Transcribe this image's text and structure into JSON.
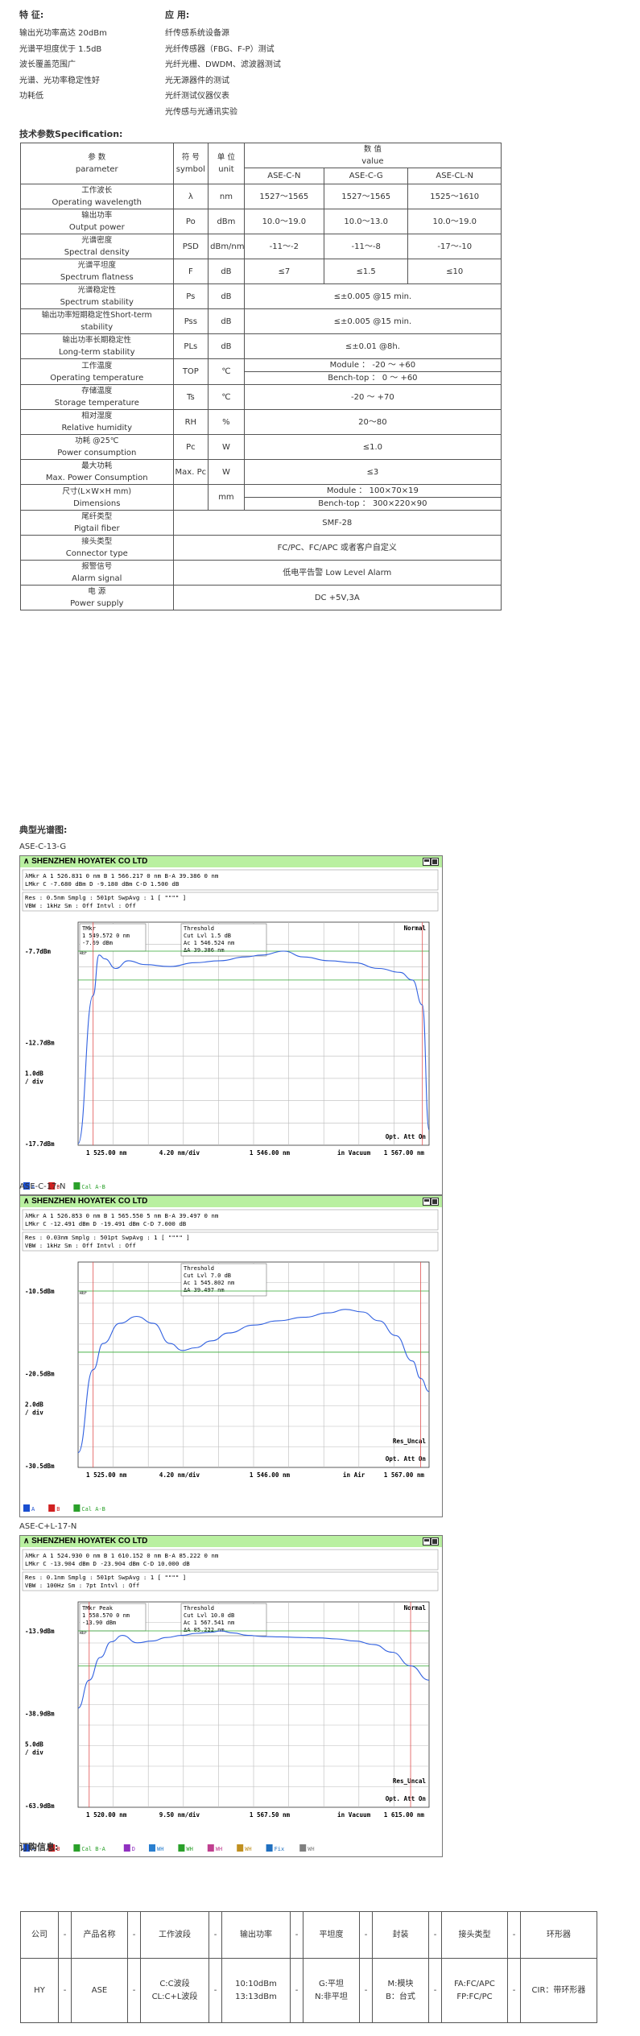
{
  "features": {
    "heading": "特 征:",
    "items": [
      "输出光功率高达 20dBm",
      "光谱平坦度优于 1.5dB",
      "波长覆盖范围广",
      "光谱、光功率稳定性好",
      "功耗低"
    ]
  },
  "applications": {
    "heading": "应 用:",
    "items": [
      "纤传感系统设备源",
      "光纤传感器（FBG、F-P）测试",
      "光纤光栅、DWDM、滤波器测试",
      "光无源器件的测试",
      "光纤测试仪器仪表",
      "光传感与光通讯实验"
    ]
  },
  "spec_title": "技术参数Specification:",
  "spec": {
    "header": {
      "param_cn": "参 数",
      "param_en": "parameter",
      "sym_cn": "符 号",
      "sym_en": "symbol",
      "unit_cn": "单 位",
      "unit_en": "unit",
      "value_cn": "数 值",
      "value_en": "value",
      "models": [
        "ASE-C-N",
        "ASE-C-G",
        "ASE-CL-N"
      ]
    },
    "rows": [
      {
        "cn": "工作波长",
        "en": "Operating wavelength",
        "sym": "λ",
        "unit": "nm",
        "vals": [
          "1527～1565",
          "1527～1565",
          "1525～1610"
        ]
      },
      {
        "cn": "输出功率",
        "en": "Output power",
        "sym": "Po",
        "unit": "dBm",
        "vals": [
          "10.0～19.0",
          "10.0～13.0",
          "10.0～19.0"
        ]
      },
      {
        "cn": "光谱密度",
        "en": "Spectral density",
        "sym": "PSD",
        "unit": "dBm/nm",
        "vals": [
          "-11～-2",
          "-11～-8",
          "-17～-10"
        ]
      },
      {
        "cn": "光谱平坦度",
        "en": "Spectrum flatness",
        "sym": "F",
        "unit": "dB",
        "vals": [
          "≤7",
          "≤1.5",
          "≤10"
        ]
      },
      {
        "cn": "光谱稳定性",
        "en": "Spectrum stability",
        "sym": "Ps",
        "unit": "dB",
        "span": "≤±0.005  @15 min."
      },
      {
        "cn": "输出功率短期稳定性Short-term",
        "en": "stability",
        "sym": "Pss",
        "unit": "dB",
        "span": "≤±0.005  @15 min."
      },
      {
        "cn": "输出功率长期稳定性",
        "en": "Long-term stability",
        "sym": "PLs",
        "unit": "dB",
        "span": "≤±0.01  @8h."
      },
      {
        "cn": "工作温度",
        "en": "Operating temperature",
        "sym": "TOP",
        "unit": "℃",
        "split": [
          "Module ： -20 ～ +60",
          "Bench-top ： 0 ～ +60"
        ]
      },
      {
        "cn": "存储温度",
        "en": "Storage temperature",
        "sym": "Ts",
        "unit": "℃",
        "span": "-20 ～ +70"
      },
      {
        "cn": "相对湿度",
        "en": "Relative humidity",
        "sym": "RH",
        "unit": "%",
        "span": "20～80"
      },
      {
        "cn": "功耗 @25℃",
        "en": "Power consumption",
        "sym": "Pc",
        "unit": "W",
        "span": "≤1.0"
      },
      {
        "cn": "最大功耗",
        "en": "Max. Power Consumption",
        "sym": "Max. Pc",
        "unit": "W",
        "span": "≤3"
      },
      {
        "cn": "尺寸(L×W×H mm)",
        "en": "Dimensions",
        "sym": "",
        "unit": "mm",
        "split": [
          "Module ：  100×70×19",
          "Bench-top ：  300×220×90"
        ]
      },
      {
        "cn": "尾纤类型",
        "en": "Pigtail fiber",
        "full": "SMF-28"
      },
      {
        "cn": "接头类型",
        "en": "Connector type",
        "full": "FC/PC、FC/APC 或者客户自定义"
      },
      {
        "cn": "报警信号",
        "en": "Alarm signal",
        "full": "低电平告警   Low Level Alarm"
      },
      {
        "cn": "电 源",
        "en": "Power supply",
        "full": "DC +5V,3A"
      }
    ]
  },
  "spectra_title": "典型光谱图:",
  "charts": [
    {
      "caption": "ASE-C-13-G",
      "company": "SHENZHEN HOYATEK CO LTD",
      "marker_lines": [
        "λMkr      A       1 526.831 0   nm        B         1 566.217 0   nm     B-A        39.386 0   nm",
        "LMkr      C          -7.680   dBm         D            -9.180   dBm     C-D         1.500   dB"
      ],
      "setup_lines": [
        "Res :  0.5nm          Smplg :    501pt      SwpAvg :    1 [   \"\"\"\" ]",
        "VBW :  1kHz      Sm :  Off    Intvl :  Off"
      ],
      "ref_levels": [
        "-7.7dBm",
        "-12.7dBm",
        "-17.7dBm"
      ],
      "scale": [
        "1.0dB",
        "/ div"
      ],
      "mode": "Normal",
      "notes": [
        "Opt. Att On"
      ],
      "footer": [
        "1 525.00 nm",
        "4.20 nm/div",
        "1 546.00 nm",
        "in Vacuum",
        "1 567.00 nm"
      ],
      "box_lines": [
        "TMkr",
        "1 549.572 0   nm",
        "-7.69  dBm"
      ],
      "thr_lines": [
        "Threshold",
        "Cut Lvl          1.5  dB",
        "Ac           1 546.524  nm",
        "ΔA              39.386  nm"
      ],
      "traces": [
        "A",
        "B",
        "Cal A-B"
      ],
      "chart_data": {
        "type": "line",
        "x_range": [
          1525.0,
          1567.0
        ],
        "y_range": [
          -17.7,
          -7.7
        ],
        "series": [
          {
            "values": [
              [
                1525.0,
                -17.7
              ],
              [
                1526.8,
                -10.0
              ],
              [
                1527.5,
                -7.9
              ],
              [
                1528.2,
                -8.1
              ],
              [
                1529.5,
                -8.6
              ],
              [
                1531.0,
                -8.2
              ],
              [
                1533.0,
                -8.4
              ],
              [
                1536.0,
                -8.5
              ],
              [
                1539.0,
                -8.3
              ],
              [
                1542.0,
                -8.2
              ],
              [
                1545.0,
                -8.0
              ],
              [
                1547.0,
                -7.9
              ],
              [
                1549.6,
                -7.7
              ],
              [
                1552.0,
                -8.0
              ],
              [
                1555.0,
                -8.2
              ],
              [
                1558.0,
                -8.3
              ],
              [
                1561.0,
                -8.6
              ],
              [
                1563.5,
                -8.8
              ],
              [
                1565.0,
                -9.2
              ],
              [
                1566.2,
                -10.5
              ],
              [
                1567.0,
                -17.0
              ]
            ]
          }
        ]
      }
    },
    {
      "caption": "ASE-C-17-N",
      "company": "SHENZHEN HOYATEK CO LTD",
      "marker_lines": [
        "λMkr      A       1 526.853 0   nm        B         1 565.550 5   nm     B-A        39.497 0   nm",
        "LMkr      C         -12.491   dBm         D           -19.491   dBm     C-D         7.000   dB"
      ],
      "setup_lines": [
        "Res :  0.03nm         Smplg :    501pt      SwpAvg :    1 [   \"\"\"\" ]",
        "VBW :  1kHz      Sm :  Off    Intvl :  Off"
      ],
      "ref_levels": [
        "-10.5dBm",
        "-20.5dBm",
        "-30.5dBm"
      ],
      "scale": [
        "2.0dB",
        "/ div"
      ],
      "mode": "",
      "notes": [
        "Res_Uncal",
        "Opt. Att On"
      ],
      "footer": [
        "1 525.00 nm",
        "4.20 nm/div",
        "1 546.00 nm",
        "in Air",
        "1 567.00 nm"
      ],
      "box_lines": [],
      "thr_lines": [
        "Threshold",
        "Cut Lvl          7.0  dB",
        "Ac           1 545.802  nm",
        "ΔA              39.497  nm"
      ],
      "traces": [
        "A",
        "B",
        "Cal A-B"
      ],
      "chart_data": {
        "type": "line",
        "x_range": [
          1525.0,
          1567.0
        ],
        "y_range": [
          -30.5,
          -10.5
        ],
        "series": [
          {
            "values": [
              [
                1525.0,
                -29.0
              ],
              [
                1526.8,
                -19.5
              ],
              [
                1528.0,
                -16.5
              ],
              [
                1530.0,
                -14.2
              ],
              [
                1532.0,
                -13.4
              ],
              [
                1534.0,
                -14.2
              ],
              [
                1536.0,
                -16.5
              ],
              [
                1537.5,
                -17.3
              ],
              [
                1539.0,
                -17.0
              ],
              [
                1541.0,
                -16.2
              ],
              [
                1543.0,
                -15.3
              ],
              [
                1546.0,
                -14.4
              ],
              [
                1549.0,
                -13.9
              ],
              [
                1552.0,
                -13.5
              ],
              [
                1555.0,
                -13.0
              ],
              [
                1557.0,
                -12.6
              ],
              [
                1559.0,
                -12.9
              ],
              [
                1561.0,
                -13.9
              ],
              [
                1563.0,
                -15.6
              ],
              [
                1565.0,
                -18.5
              ],
              [
                1566.0,
                -20.5
              ],
              [
                1567.0,
                -22.0
              ]
            ]
          }
        ]
      }
    },
    {
      "caption": "ASE-C+L-17-N",
      "company": "SHENZHEN HOYATEK CO LTD",
      "marker_lines": [
        "λMkr      A       1 524.930 0   nm        B         1 610.152 0   nm     B-A        85.222 0   nm",
        "LMkr      C         -13.904   dBm         D           -23.904   dBm     C-D        10.000   dB"
      ],
      "setup_lines": [
        "Res :  0.1nm          Smplg :    501pt      SwpAvg :    1 [   \"\"\"\" ]",
        "VBW :  100Hz      Sm :  7pt    Intvl :  Off"
      ],
      "ref_levels": [
        "-13.9dBm",
        "-38.9dBm",
        "-63.9dBm"
      ],
      "scale": [
        "5.0dB",
        "/ div"
      ],
      "mode": "Normal",
      "notes": [
        "Res_Uncal",
        "Opt. Att On"
      ],
      "footer": [
        "1 520.00 nm",
        "9.50 nm/div",
        "1 567.50 nm",
        "in Vacuum",
        "1 615.00 nm"
      ],
      "box_lines": [
        "TMkr    Peak",
        "1 558.570 0   nm",
        "-13.90  dBm"
      ],
      "thr_lines": [
        "Threshold",
        "Cut Lvl         10.0  dB",
        "Ac           1 567.541  nm",
        "ΔA              85.222  nm"
      ],
      "traces": [
        "A",
        "B",
        "Cal B-A",
        "D",
        "WH",
        "WH",
        "WH",
        "WH",
        "Fix",
        "WH"
      ],
      "chart_data": {
        "type": "line",
        "x_range": [
          1520.0,
          1615.0
        ],
        "y_range": [
          -63.9,
          -13.9
        ],
        "series": [
          {
            "values": [
              [
                1520.0,
                -36.0
              ],
              [
                1523.0,
                -28.0
              ],
              [
                1526.0,
                -21.5
              ],
              [
                1529.0,
                -17.0
              ],
              [
                1532.0,
                -15.2
              ],
              [
                1536.0,
                -17.3
              ],
              [
                1540.0,
                -16.8
              ],
              [
                1544.0,
                -15.8
              ],
              [
                1548.0,
                -15.2
              ],
              [
                1552.0,
                -14.6
              ],
              [
                1556.0,
                -14.3
              ],
              [
                1558.6,
                -13.9
              ],
              [
                1562.0,
                -14.5
              ],
              [
                1566.0,
                -15.2
              ],
              [
                1570.0,
                -15.5
              ],
              [
                1575.0,
                -15.6
              ],
              [
                1580.0,
                -15.8
              ],
              [
                1585.0,
                -15.9
              ],
              [
                1590.0,
                -16.2
              ],
              [
                1595.0,
                -16.8
              ],
              [
                1600.0,
                -17.8
              ],
              [
                1605.0,
                -20.0
              ],
              [
                1610.0,
                -23.9
              ],
              [
                1615.0,
                -28.0
              ]
            ]
          }
        ]
      }
    }
  ],
  "order_title": "订购信息:",
  "order": {
    "header": [
      "公司",
      "-",
      "产品名称",
      "-",
      "工作波段",
      "-",
      "输出功率",
      "-",
      "平坦度",
      "-",
      "封装",
      "-",
      "接头类型",
      "-",
      "环形器"
    ],
    "row": [
      "HY",
      "-",
      "ASE",
      "-",
      "C:C波段\nCL:C+L波段",
      "-",
      "10:10dBm\n13:13dBm",
      "-",
      "G:平坦\nN:非平坦",
      "-",
      "M:模块\nB：台式",
      "-",
      "FA:FC/APC\nFP:FC/PC",
      "-",
      "CIR：带环形器"
    ]
  }
}
